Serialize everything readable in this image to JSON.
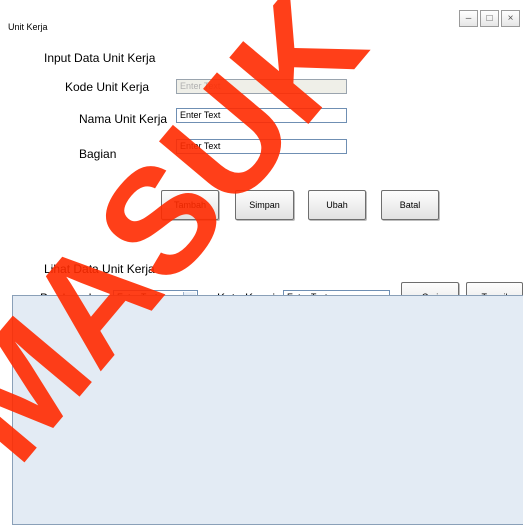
{
  "window": {
    "title": "Unit Kerja",
    "controls": {
      "minimize": "–",
      "maximize": "□",
      "close": "×"
    }
  },
  "input_section": {
    "title": "Input Data Unit Kerja",
    "fields": [
      {
        "label": "Kode  Unit Kerja",
        "placeholder": "Enter Text",
        "disabled": true
      },
      {
        "label": "Nama  Unit Kerja",
        "placeholder": "Enter Text",
        "disabled": false
      },
      {
        "label": "Bagian",
        "placeholder": "Enter Text",
        "disabled": false
      }
    ],
    "buttons": [
      "Tambah",
      "Simpan",
      "Ubah",
      "Batal"
    ]
  },
  "view_section": {
    "title": "Lihat Data Unit Kerja",
    "filter_label": "Berdasarkan",
    "filter_value": "Enter Text",
    "keyword_label": "Kata Kunci",
    "keyword_placeholder": "Enter Text",
    "search_button": "Cari",
    "show_button": "Tampil"
  },
  "watermark": {
    "text": "MASUK",
    "color": "#ff2a00"
  }
}
